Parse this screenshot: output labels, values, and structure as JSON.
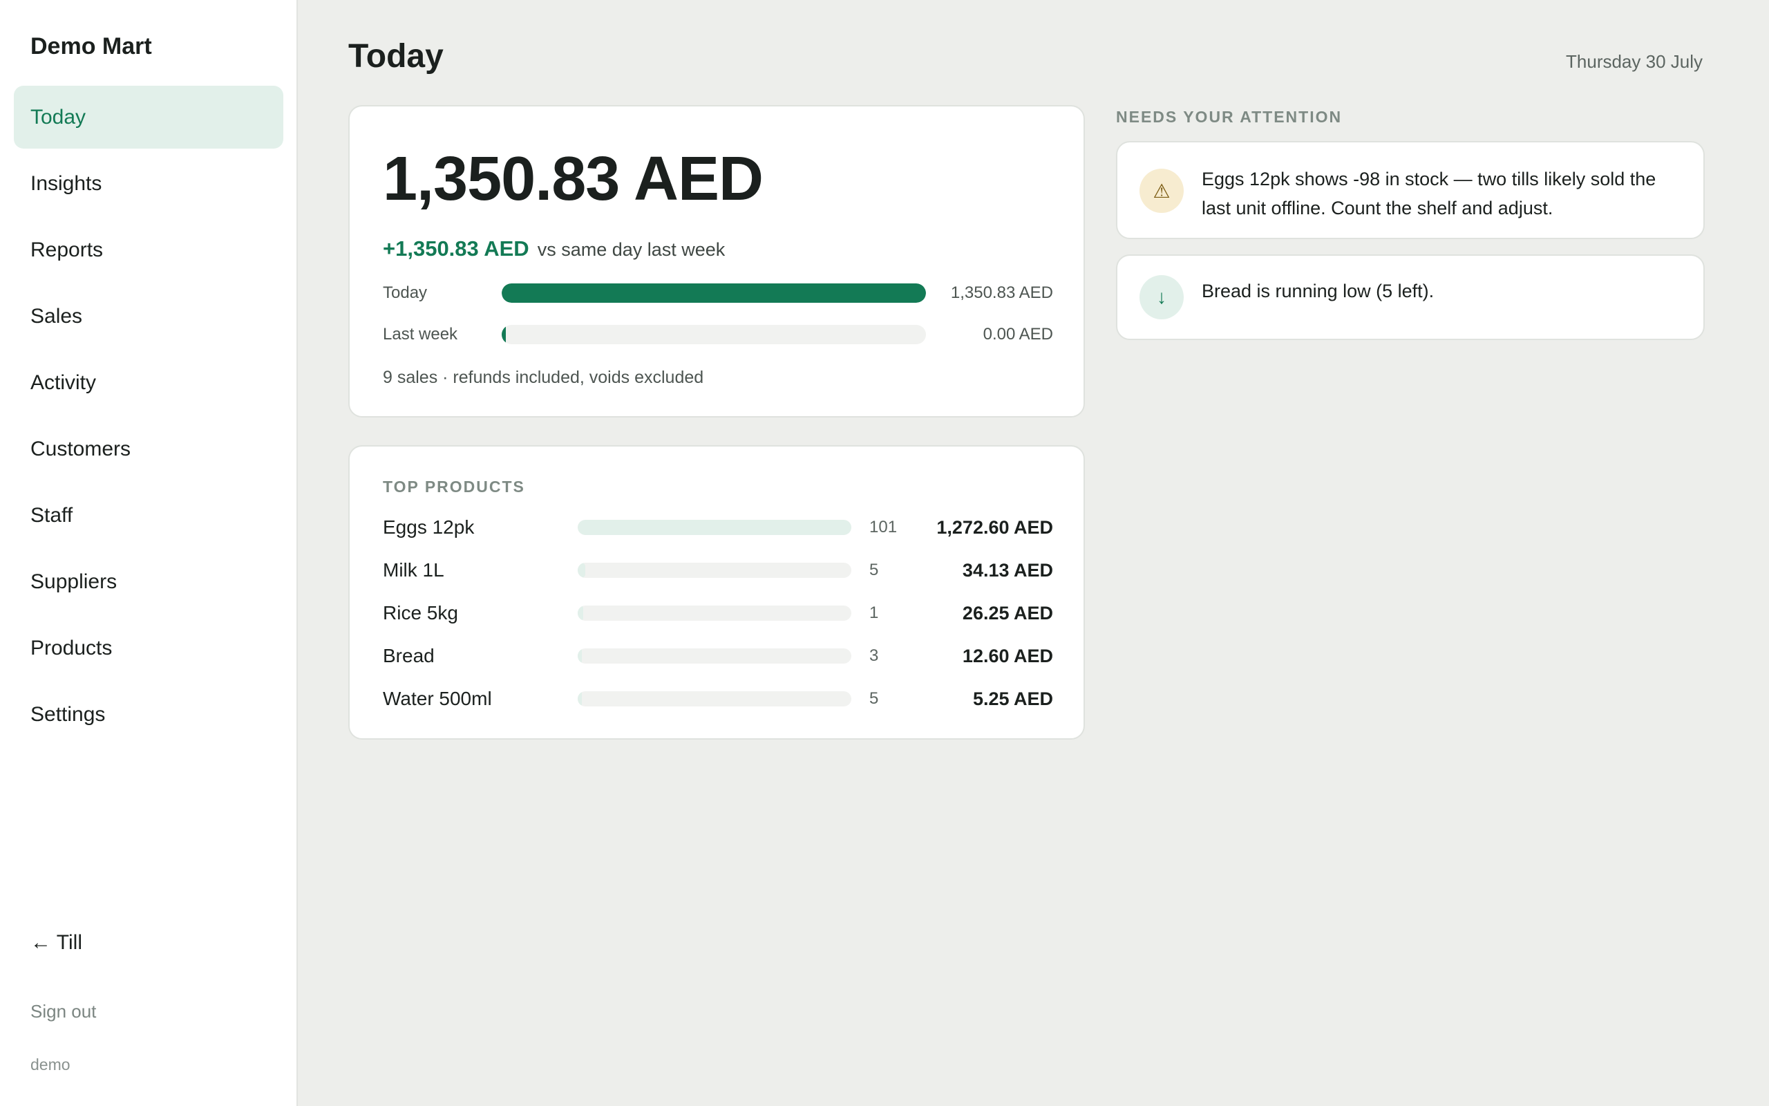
{
  "sidebar": {
    "brand": "Demo Mart",
    "items": [
      {
        "label": "Today",
        "active": true
      },
      {
        "label": "Insights"
      },
      {
        "label": "Reports"
      },
      {
        "label": "Sales"
      },
      {
        "label": "Activity"
      },
      {
        "label": "Customers"
      },
      {
        "label": "Staff"
      },
      {
        "label": "Suppliers"
      },
      {
        "label": "Products"
      },
      {
        "label": "Settings"
      }
    ],
    "till_link": "← Till",
    "sign_out": "Sign out",
    "user": "demo"
  },
  "header": {
    "title": "Today",
    "date": "Thursday 30 July"
  },
  "revenue": {
    "amount": "1,350.83 AED",
    "delta_value": "+1,350.83 AED",
    "delta_text": "vs same day last week",
    "rows": [
      {
        "label": "Today",
        "value": "1,350.83 AED",
        "fraction": 1.0
      },
      {
        "label": "Last week",
        "value": "0.00 AED",
        "fraction": 0.0
      }
    ],
    "note": "9 sales · refunds included, voids excluded"
  },
  "top_products": {
    "label": "TOP PRODUCTS",
    "items": [
      {
        "name": "Eggs 12pk",
        "qty": "101",
        "amount": "1,272.60 AED",
        "fraction": 1.0
      },
      {
        "name": "Milk 1L",
        "qty": "5",
        "amount": "34.13 AED",
        "fraction": 0.027
      },
      {
        "name": "Rice 5kg",
        "qty": "1",
        "amount": "26.25 AED",
        "fraction": 0.021
      },
      {
        "name": "Bread",
        "qty": "3",
        "amount": "12.60 AED",
        "fraction": 0.01
      },
      {
        "name": "Water 500ml",
        "qty": "5",
        "amount": "5.25 AED",
        "fraction": 0.004
      }
    ]
  },
  "attention": {
    "label": "NEEDS YOUR ATTENTION",
    "alerts": [
      {
        "icon": "warning-icon",
        "glyph": "⚠",
        "kind": "warn",
        "text": "Eggs 12pk shows -98 in stock — two tills likely sold the last unit offline. Count the shelf and adjust."
      },
      {
        "icon": "arrow-down-icon",
        "glyph": "↓",
        "kind": "low",
        "text": "Bread is running low (5 left)."
      }
    ]
  },
  "colors": {
    "accent": "#137a55",
    "accent_soft": "#e2f0ea",
    "warning_soft": "#f7ecd0",
    "background": "#edeeeb"
  }
}
